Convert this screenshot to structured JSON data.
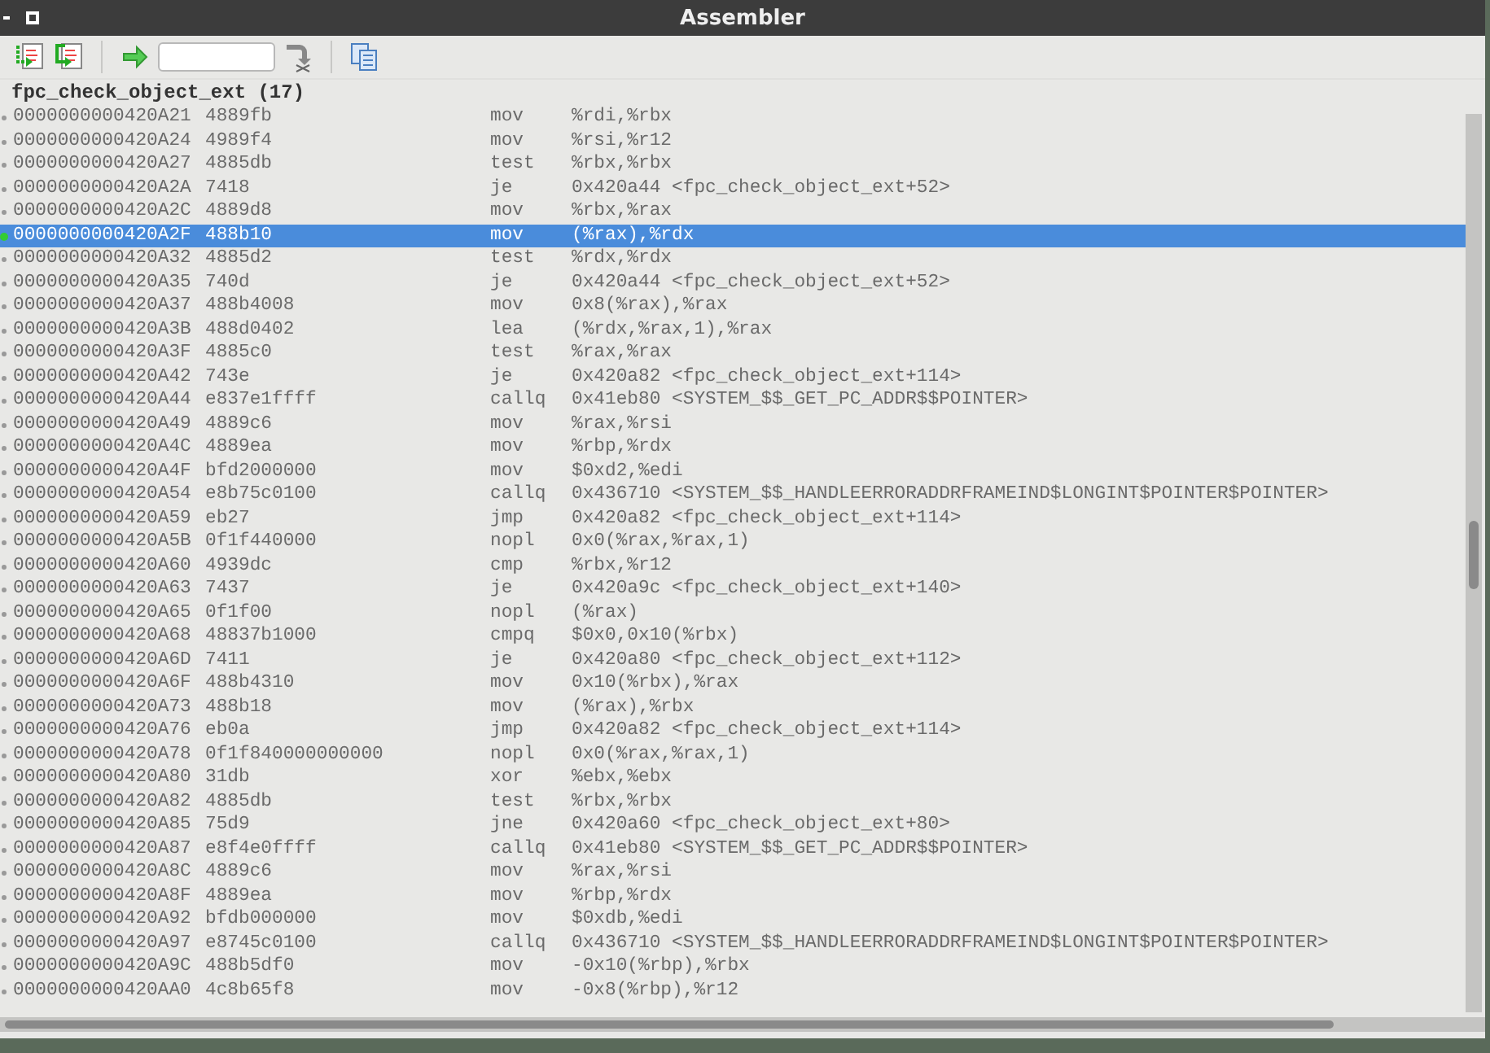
{
  "window": {
    "title": "Assembler"
  },
  "function_header": "fpc_check_object_ext (17)",
  "rows": [
    {
      "address": "0000000000420A21",
      "bytes": "4889fb",
      "mnemonic": "mov",
      "operands": "%rdi,%rbx",
      "selected": false
    },
    {
      "address": "0000000000420A24",
      "bytes": "4989f4",
      "mnemonic": "mov",
      "operands": "%rsi,%r12",
      "selected": false
    },
    {
      "address": "0000000000420A27",
      "bytes": "4885db",
      "mnemonic": "test",
      "operands": "%rbx,%rbx",
      "selected": false
    },
    {
      "address": "0000000000420A2A",
      "bytes": "7418",
      "mnemonic": "je",
      "operands": "0x420a44 <fpc_check_object_ext+52>",
      "selected": false
    },
    {
      "address": "0000000000420A2C",
      "bytes": "4889d8",
      "mnemonic": "mov",
      "operands": "%rbx,%rax",
      "selected": false
    },
    {
      "address": "0000000000420A2F",
      "bytes": "488b10",
      "mnemonic": "mov",
      "operands": "(%rax),%rdx",
      "selected": true
    },
    {
      "address": "0000000000420A32",
      "bytes": "4885d2",
      "mnemonic": "test",
      "operands": "%rdx,%rdx",
      "selected": false
    },
    {
      "address": "0000000000420A35",
      "bytes": "740d",
      "mnemonic": "je",
      "operands": "0x420a44 <fpc_check_object_ext+52>",
      "selected": false
    },
    {
      "address": "0000000000420A37",
      "bytes": "488b4008",
      "mnemonic": "mov",
      "operands": "0x8(%rax),%rax",
      "selected": false
    },
    {
      "address": "0000000000420A3B",
      "bytes": "488d0402",
      "mnemonic": "lea",
      "operands": "(%rdx,%rax,1),%rax",
      "selected": false
    },
    {
      "address": "0000000000420A3F",
      "bytes": "4885c0",
      "mnemonic": "test",
      "operands": "%rax,%rax",
      "selected": false
    },
    {
      "address": "0000000000420A42",
      "bytes": "743e",
      "mnemonic": "je",
      "operands": "0x420a82 <fpc_check_object_ext+114>",
      "selected": false
    },
    {
      "address": "0000000000420A44",
      "bytes": "e837e1ffff",
      "mnemonic": "callq",
      "operands": "0x41eb80 <SYSTEM_$$_GET_PC_ADDR$$POINTER>",
      "selected": false
    },
    {
      "address": "0000000000420A49",
      "bytes": "4889c6",
      "mnemonic": "mov",
      "operands": "%rax,%rsi",
      "selected": false
    },
    {
      "address": "0000000000420A4C",
      "bytes": "4889ea",
      "mnemonic": "mov",
      "operands": "%rbp,%rdx",
      "selected": false
    },
    {
      "address": "0000000000420A4F",
      "bytes": "bfd2000000",
      "mnemonic": "mov",
      "operands": "$0xd2,%edi",
      "selected": false
    },
    {
      "address": "0000000000420A54",
      "bytes": "e8b75c0100",
      "mnemonic": "callq",
      "operands": "0x436710 <SYSTEM_$$_HANDLEERRORADDRFRAMEIND$LONGINT$POINTER$POINTER>",
      "selected": false
    },
    {
      "address": "0000000000420A59",
      "bytes": "eb27",
      "mnemonic": "jmp",
      "operands": "0x420a82 <fpc_check_object_ext+114>",
      "selected": false
    },
    {
      "address": "0000000000420A5B",
      "bytes": "0f1f440000",
      "mnemonic": "nopl",
      "operands": "0x0(%rax,%rax,1)",
      "selected": false
    },
    {
      "address": "0000000000420A60",
      "bytes": "4939dc",
      "mnemonic": "cmp",
      "operands": "%rbx,%r12",
      "selected": false
    },
    {
      "address": "0000000000420A63",
      "bytes": "7437",
      "mnemonic": "je",
      "operands": "0x420a9c <fpc_check_object_ext+140>",
      "selected": false
    },
    {
      "address": "0000000000420A65",
      "bytes": "0f1f00",
      "mnemonic": "nopl",
      "operands": "(%rax)",
      "selected": false
    },
    {
      "address": "0000000000420A68",
      "bytes": "48837b1000",
      "mnemonic": "cmpq",
      "operands": "$0x0,0x10(%rbx)",
      "selected": false
    },
    {
      "address": "0000000000420A6D",
      "bytes": "7411",
      "mnemonic": "je",
      "operands": "0x420a80 <fpc_check_object_ext+112>",
      "selected": false
    },
    {
      "address": "0000000000420A6F",
      "bytes": "488b4310",
      "mnemonic": "mov",
      "operands": "0x10(%rbx),%rax",
      "selected": false
    },
    {
      "address": "0000000000420A73",
      "bytes": "488b18",
      "mnemonic": "mov",
      "operands": "(%rax),%rbx",
      "selected": false
    },
    {
      "address": "0000000000420A76",
      "bytes": "eb0a",
      "mnemonic": "jmp",
      "operands": "0x420a82 <fpc_check_object_ext+114>",
      "selected": false
    },
    {
      "address": "0000000000420A78",
      "bytes": "0f1f840000000000",
      "mnemonic": "nopl",
      "operands": "0x0(%rax,%rax,1)",
      "selected": false
    },
    {
      "address": "0000000000420A80",
      "bytes": "31db",
      "mnemonic": "xor",
      "operands": "%ebx,%ebx",
      "selected": false
    },
    {
      "address": "0000000000420A82",
      "bytes": "4885db",
      "mnemonic": "test",
      "operands": "%rbx,%rbx",
      "selected": false
    },
    {
      "address": "0000000000420A85",
      "bytes": "75d9",
      "mnemonic": "jne",
      "operands": "0x420a60 <fpc_check_object_ext+80>",
      "selected": false
    },
    {
      "address": "0000000000420A87",
      "bytes": "e8f4e0ffff",
      "mnemonic": "callq",
      "operands": "0x41eb80 <SYSTEM_$$_GET_PC_ADDR$$POINTER>",
      "selected": false
    },
    {
      "address": "0000000000420A8C",
      "bytes": "4889c6",
      "mnemonic": "mov",
      "operands": "%rax,%rsi",
      "selected": false
    },
    {
      "address": "0000000000420A8F",
      "bytes": "4889ea",
      "mnemonic": "mov",
      "operands": "%rbp,%rdx",
      "selected": false
    },
    {
      "address": "0000000000420A92",
      "bytes": "bfdb000000",
      "mnemonic": "mov",
      "operands": "$0xdb,%edi",
      "selected": false
    },
    {
      "address": "0000000000420A97",
      "bytes": "e8745c0100",
      "mnemonic": "callq",
      "operands": "0x436710 <SYSTEM_$$_HANDLEERRORADDRFRAMEIND$LONGINT$POINTER$POINTER>",
      "selected": false
    },
    {
      "address": "0000000000420A9C",
      "bytes": "488b5df0",
      "mnemonic": "mov",
      "operands": "-0x10(%rbp),%rbx",
      "selected": false
    },
    {
      "address": "0000000000420AA0",
      "bytes": "4c8b65f8",
      "mnemonic": "mov",
      "operands": "-0x8(%rbp),%r12",
      "selected": false
    }
  ]
}
